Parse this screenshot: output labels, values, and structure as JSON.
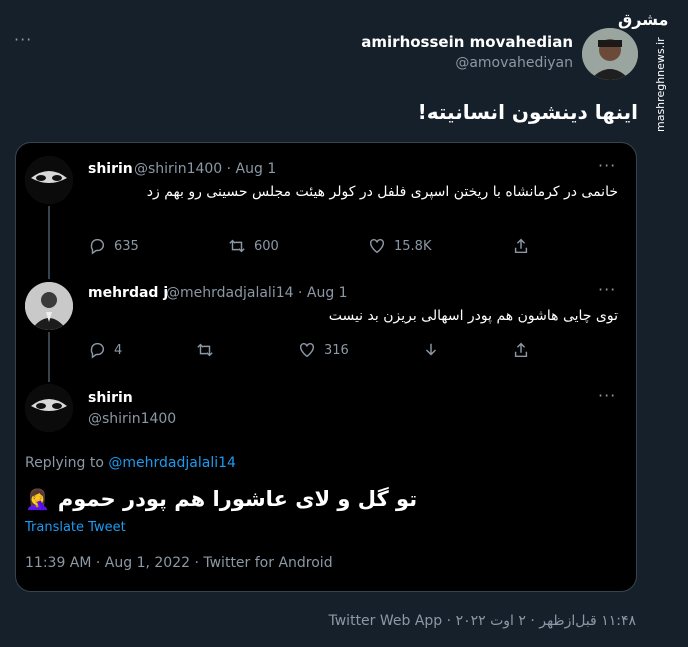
{
  "watermark": "mashreghnews.ir",
  "header": {
    "more": "···",
    "display_name": "amirhossein movahedian",
    "handle": "@amovahediyan"
  },
  "main_tweet_text": "اینها دینشون انسانیته!",
  "quoted": {
    "tweet1": {
      "name": "shirin",
      "meta": "@shirin1400 · Aug 1",
      "text": "خانمی در کرمانشاه با ریختن اسپری فلفل در کولر هیئت مجلس حسینی رو بهم زد",
      "replies": "635",
      "retweets": "600",
      "likes": "15.8K"
    },
    "tweet2": {
      "name": "mehrdad j",
      "meta": "@mehrdadjalali14 · Aug 1",
      "text": "توی چایی هاشون هم پودر اسهالی بریزن بد نیست",
      "replies": "4",
      "likes": "316"
    },
    "tweet3": {
      "name": "shirin",
      "handle": "@shirin1400",
      "replying_prefix": "Replying to",
      "replying_to": "@mehrdadjalali14",
      "text": "تو گل و لای عاشورا هم پودر حموم",
      "emoji": "🤦‍♀️",
      "translate": "Translate Tweet",
      "timestamp": "11:39 AM · Aug 1, 2022 · Twitter for Android"
    }
  },
  "footer": "۱۱:۴۸ قبل‌ازظهر · ۲ اوت ۲۰۲۲ · Twitter Web App",
  "colors": {
    "background": "#15202b",
    "card": "#000000",
    "accent": "#1d9bf0",
    "muted": "#8b98a5"
  }
}
